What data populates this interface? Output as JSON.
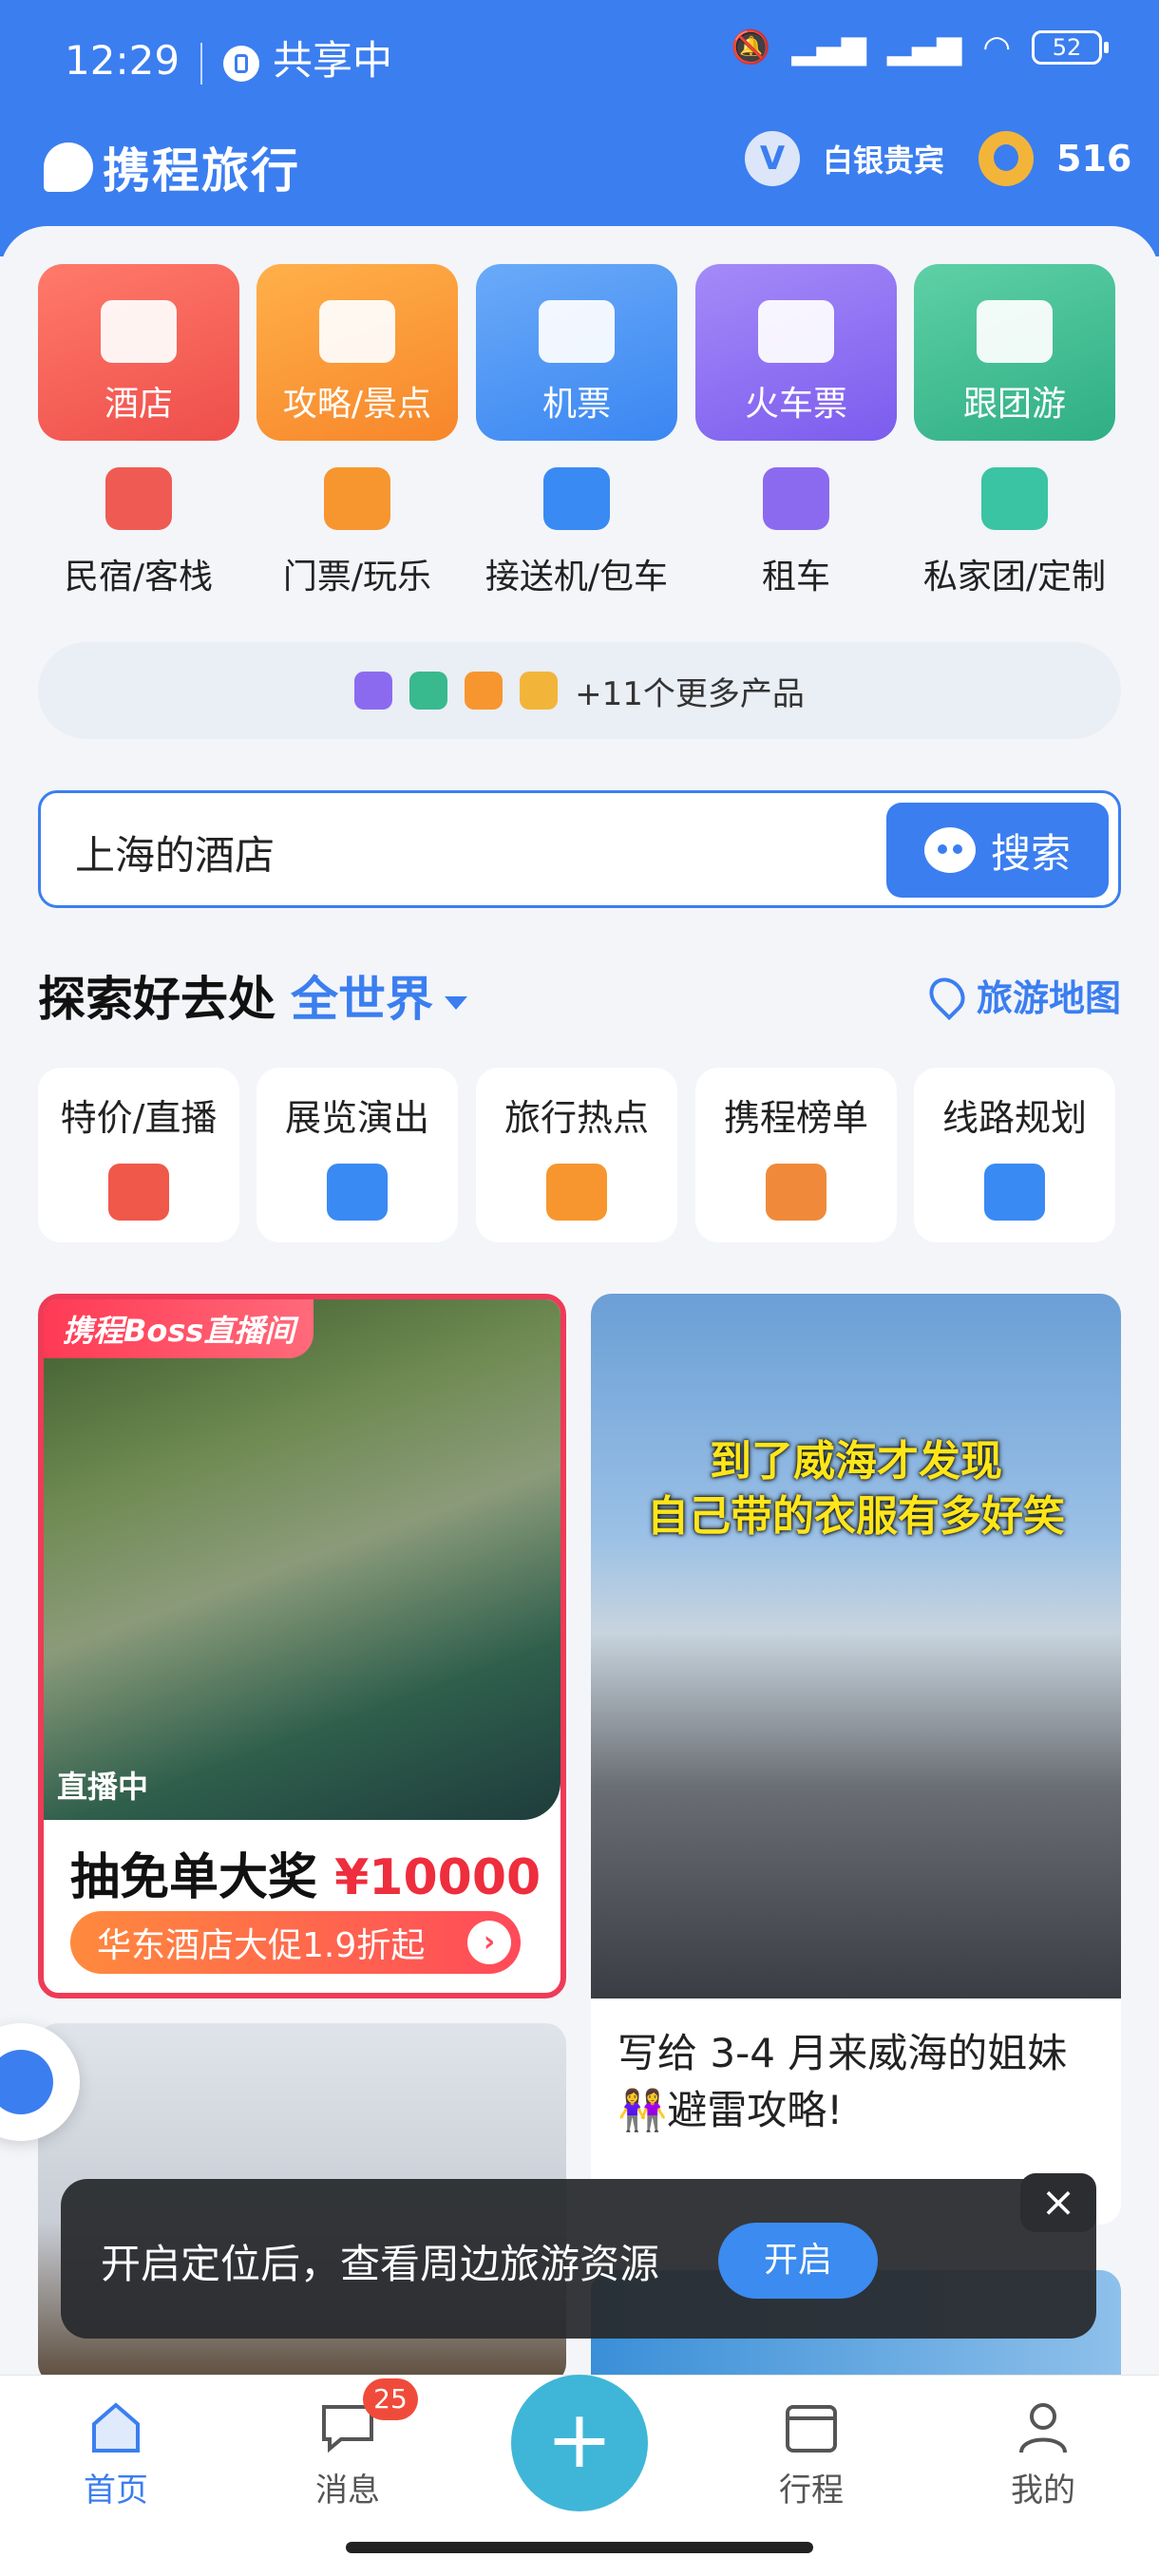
{
  "status_bar": {
    "time": "12:29",
    "share": "共享中",
    "battery": "52"
  },
  "header": {
    "logo": "携程旅行",
    "member_badge": "V",
    "member_level": "白银贵宾",
    "points": "516"
  },
  "categories": [
    {
      "label": "酒店",
      "color": "#ef5b52"
    },
    {
      "label": "攻略/景点",
      "color": "#f7962f"
    },
    {
      "label": "机票",
      "color": "#3a8af3"
    },
    {
      "label": "火车票",
      "color": "#8b6af0"
    },
    {
      "label": "跟团游",
      "color": "#38b98e"
    }
  ],
  "sub_categories": [
    {
      "label": "民宿/客栈",
      "color": "#ef5b52"
    },
    {
      "label": "门票/玩乐",
      "color": "#f7962f"
    },
    {
      "label": "接送机/包车",
      "color": "#3a8af3"
    },
    {
      "label": "租车",
      "color": "#8b6af0"
    },
    {
      "label": "私家团/定制",
      "color": "#3ac4a4"
    }
  ],
  "more_products": "+11个更多产品",
  "search": {
    "value": "上海的酒店",
    "button": "搜索"
  },
  "explore": {
    "title": "探索好去处",
    "region": "全世界",
    "map_link": "旅游地图"
  },
  "chips": [
    {
      "label": "特价/直播",
      "color": "#f0584a"
    },
    {
      "label": "展览演出",
      "color": "#3a8af3"
    },
    {
      "label": "旅行热点",
      "color": "#f7962f"
    },
    {
      "label": "携程榜单",
      "color": "#f08a3a"
    },
    {
      "label": "线路规划",
      "color": "#3a8af3"
    }
  ],
  "feed": {
    "card1": {
      "tag": "携程Boss直播间",
      "live": "直播中",
      "promo": "抽免单大奖",
      "price": "¥10000",
      "sale": "华东酒店大促1.9折起"
    },
    "card2": {
      "overlay_line1": "到了威海才发现",
      "overlay_line2": "自己带的衣服有多好笑",
      "title": "写给 3-4 月来威海的姐妹👭避雷攻略!"
    }
  },
  "toast": {
    "message": "开启定位后，查看周边旅游资源",
    "button": "开启",
    "close": "×"
  },
  "tabbar": {
    "home": "首页",
    "messages": "消息",
    "messages_badge": "25",
    "add": "+",
    "trips": "行程",
    "mine": "我的"
  }
}
